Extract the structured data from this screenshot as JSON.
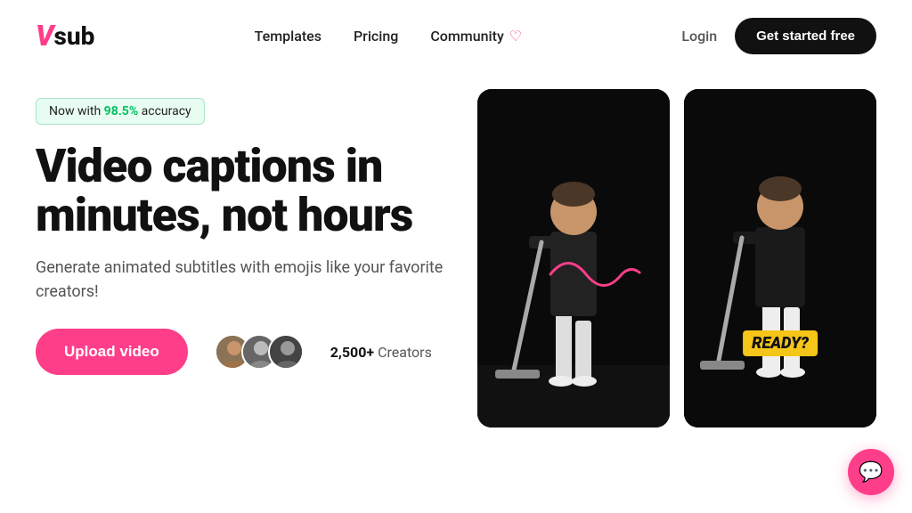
{
  "header": {
    "logo_v": "V",
    "logo_text": "sub",
    "nav": {
      "templates": "Templates",
      "pricing": "Pricing",
      "community": "Community",
      "community_heart": "♡"
    },
    "actions": {
      "login": "Login",
      "get_started": "Get started free"
    }
  },
  "hero": {
    "badge_prefix": "Now with ",
    "badge_value": "98.5%",
    "badge_suffix": " accuracy",
    "title": "Video captions in minutes, not hours",
    "subtitle": "Generate animated subtitles with emojis like your favorite creators!",
    "upload_btn": "Upload video",
    "creators_count": "2,500+",
    "creators_label": " Creators"
  },
  "video_left": {
    "has_squiggle": true,
    "ready_text": "READY?"
  },
  "chat": {
    "icon": "💬"
  },
  "colors": {
    "pink": "#ff3e8a",
    "green": "#00c060",
    "dark": "#111111"
  }
}
